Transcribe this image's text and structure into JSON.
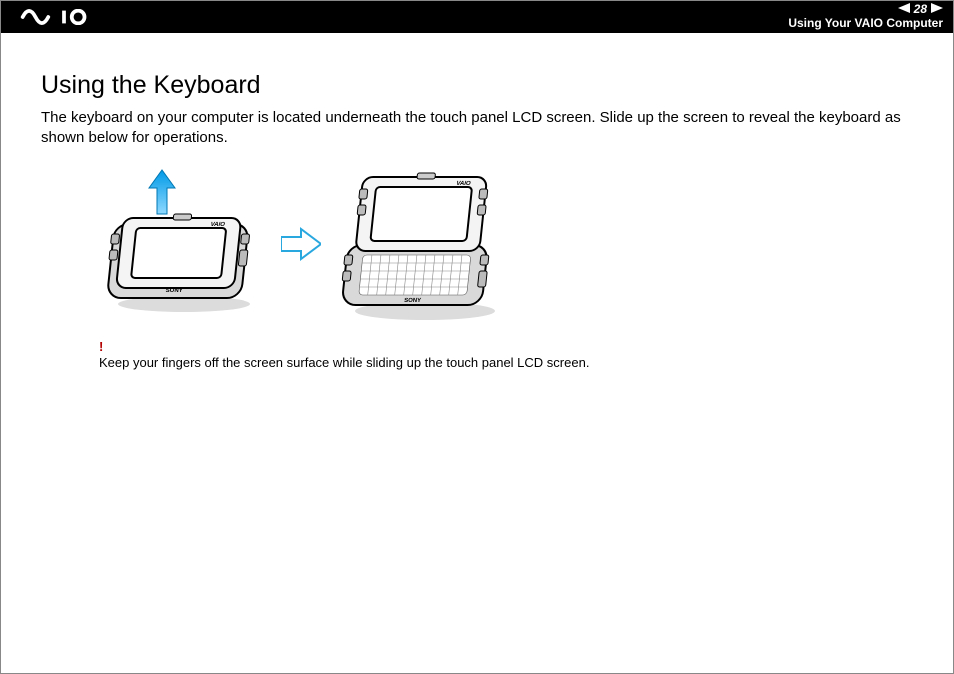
{
  "header": {
    "logo_alt": "VAIO",
    "page_number": "28",
    "section_title": "Using Your VAIO Computer"
  },
  "content": {
    "heading": "Using the Keyboard",
    "paragraph": "The keyboard on your computer is located underneath the touch panel LCD screen. Slide up the screen to reveal the keyboard as shown below for operations."
  },
  "figure": {
    "device_closed_alt": "VAIO handheld computer closed, arrow showing slide-up motion",
    "device_open_alt": "VAIO handheld computer with screen slid up revealing keyboard",
    "transition_arrow_alt": "right-pointing step arrow",
    "slide_arrow_alt": "upward slide arrow"
  },
  "caution": {
    "symbol": "!",
    "text": "Keep your fingers off the screen surface while sliding up the touch panel LCD screen."
  }
}
